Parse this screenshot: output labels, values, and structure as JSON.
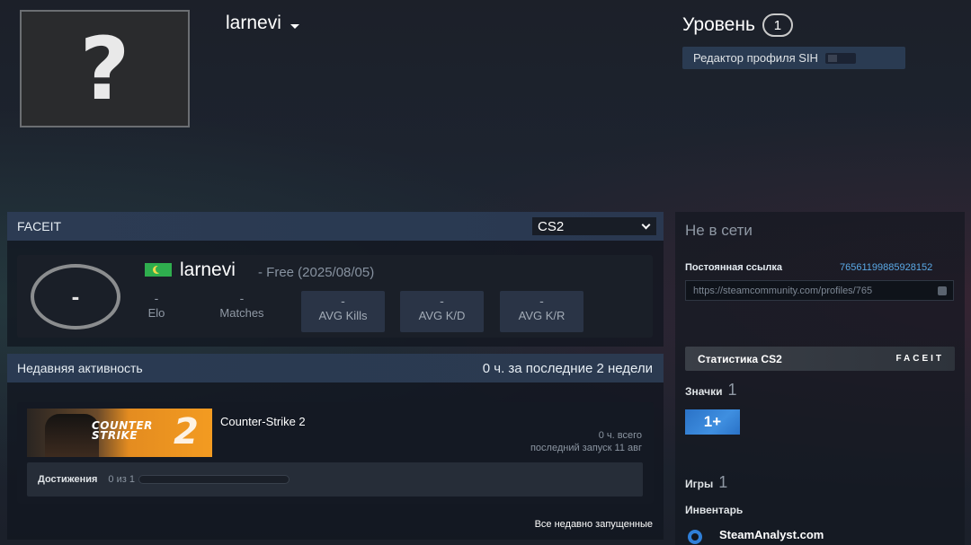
{
  "header": {
    "avatar_glyph": "?",
    "persona_name": "larnevi",
    "level_label": "Уровень",
    "level_value": "1",
    "sih_editor_label": "Редактор профиля SIH"
  },
  "faceit": {
    "title": "FACEIT",
    "game_select": "CS2",
    "level_ring": "-",
    "nickname": "larnevi",
    "membership": "- Free (2025/08/05)",
    "stats": [
      {
        "value": "-",
        "label": "Elo"
      },
      {
        "value": "-",
        "label": "Matches"
      },
      {
        "value": "-",
        "label": "AVG Kills"
      },
      {
        "value": "-",
        "label": "AVG K/D"
      },
      {
        "value": "-",
        "label": "AVG K/R"
      }
    ]
  },
  "recent": {
    "title": "Недавняя активность",
    "hours_summary": "0 ч. за последние 2 недели",
    "game": {
      "name": "Counter-Strike 2",
      "capsule_logo_line1": "COUNTER",
      "capsule_logo_line2": "STRIKE",
      "capsule_logo_num": "2",
      "hours_total": "0 ч. всего",
      "last_played": "последний запуск 11 авг",
      "achievements_label": "Достижения",
      "achievements_count": "0 из 1",
      "achievements_progress": 0
    },
    "see_all": "Все недавно запущенные"
  },
  "sidebar": {
    "status": "Не в сети",
    "permalink_label": "Постоянная ссылка",
    "steam_id": "76561199885928152",
    "permalink_url": "https://steamcommunity.com/profiles/765",
    "cs2_stats_label": "Статистика CS2",
    "faceit_logo": "FACEIT",
    "badges_label": "Значки",
    "badges_count": "1",
    "badge_text": "1+",
    "games_label": "Игры",
    "games_count": "1",
    "inventory_label": "Инвентарь",
    "steamanalyst_label": "SteamAnalyst.com"
  }
}
